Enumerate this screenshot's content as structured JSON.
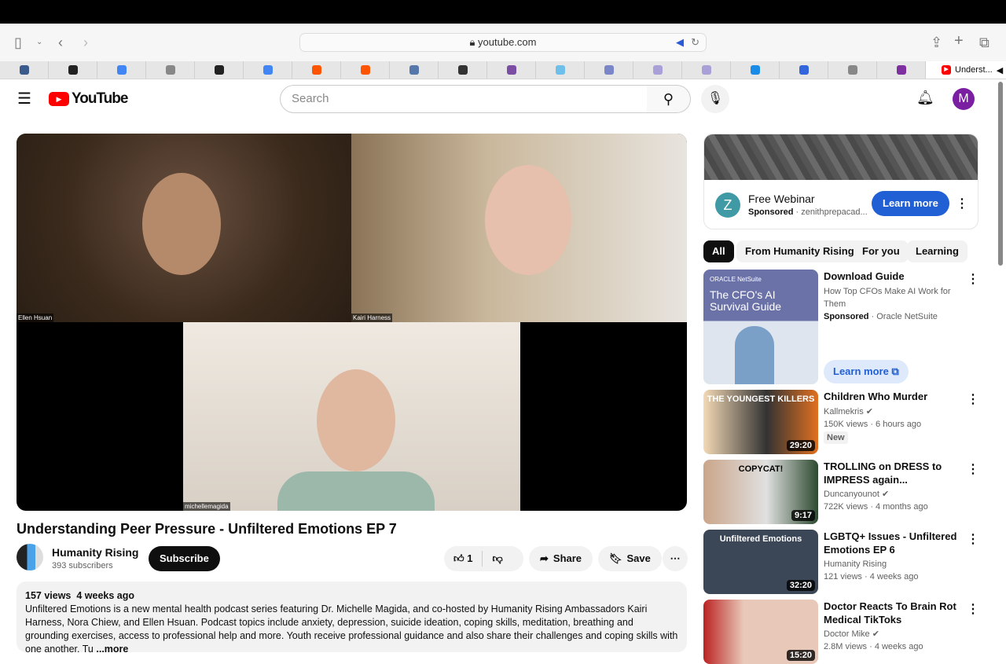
{
  "browser": {
    "url": "youtube.com",
    "active_tab": "Underst...",
    "tab_favicons": [
      "clock",
      "notion",
      "google",
      "grammarly",
      "notion",
      "google",
      "soundcloud",
      "soundcloud",
      "translate",
      "openai",
      "stripe",
      "paypal",
      "chat",
      "chat",
      "chat",
      "skype",
      "target",
      "grammarly",
      "app"
    ],
    "colors": [
      "#3b5b8c",
      "#222222",
      "#4285f4",
      "#888888",
      "#222222",
      "#4285f4",
      "#ff5500",
      "#ff5500",
      "#5577aa",
      "#333333",
      "#7b4ea3",
      "#6ec0ea",
      "#7a86c8",
      "#a9a0d8",
      "#a9a0d8",
      "#1a8ce8",
      "#3366dd",
      "#888888",
      "#7e2fa0"
    ]
  },
  "youtube": {
    "logo": "YouTube",
    "search_placeholder": "Search",
    "avatar_letter": "M"
  },
  "video": {
    "participants": [
      "Ellen Hsuan",
      "Kairi Harness",
      "michellemagida"
    ],
    "title": "Understanding Peer Pressure - Unfiltered Emotions EP 7",
    "channel": "Humanity Rising",
    "subscribers": "393 subscribers",
    "subscribe": "Subscribe",
    "likes": "1",
    "share": "Share",
    "save": "Save",
    "views": "157 views",
    "age": "4 weeks ago",
    "description": "Unfiltered Emotions is a new mental health podcast series featuring Dr. Michelle Magida, and co-hosted by Humanity Rising Ambassadors Kairi Harness, Nora Chiew, and Ellen Hsuan. Podcast topics include anxiety, depression, suicide ideation, coping skills, meditation, breathing and grounding exercises, access to professional help and more. Youth receive professional guidance and also share their challenges and coping skills with one another.  Tu",
    "more": "...more"
  },
  "ad": {
    "logo_letter": "Z",
    "title": "Free Webinar",
    "sponsored": "Sponsored",
    "advertiser": "zenithprepacad...",
    "cta": "Learn more"
  },
  "chips": [
    "All",
    "From Humanity Rising",
    "For you",
    "Learning"
  ],
  "ad2": {
    "brand": "ORACLE NetSuite",
    "headline": "The CFO's AI Survival Guide",
    "title": "Download Guide",
    "desc": "How Top CFOs Make AI Work for Them",
    "sponsored": "Sponsored",
    "advertiser": "Oracle NetSuite",
    "cta": "Learn more"
  },
  "recommendations": [
    {
      "title": "Children Who Murder",
      "channel": "Kallmekris",
      "views": "150K views",
      "age": "6 hours ago",
      "badge": "New",
      "duration": "29:20",
      "thumb_text": "THE YOUNGEST KILLERS"
    },
    {
      "title": "TROLLING on DRESS to IMPRESS again...",
      "channel": "Duncanyounot",
      "views": "722K views",
      "age": "4 months ago",
      "duration": "9:17",
      "thumb_text": "COPYCAT!"
    },
    {
      "title": "LGBTQ+ Issues - Unfiltered Emotions EP 6",
      "channel": "Humanity Rising",
      "views": "121 views",
      "age": "4 weeks ago",
      "duration": "32:20",
      "thumb_text": "Unfiltered Emotions"
    },
    {
      "title": "Doctor Reacts To Brain Rot Medical TikToks",
      "channel": "Doctor Mike",
      "views": "2.8M views",
      "age": "4 weeks ago",
      "duration": "15:20"
    }
  ]
}
